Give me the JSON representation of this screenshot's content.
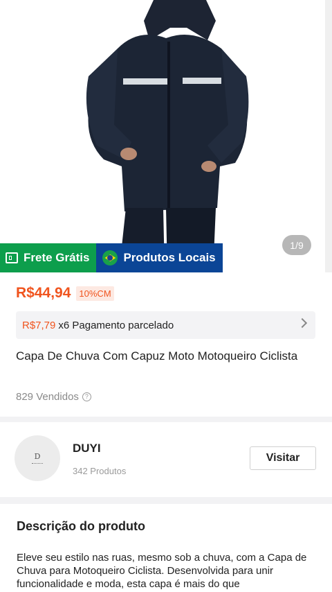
{
  "gallery": {
    "counter": "1/9"
  },
  "tags": {
    "free_shipping": "Frete Grátis",
    "local_products": "Produtos Locais"
  },
  "product": {
    "price": "R$44,94",
    "discount_badge": "10%CM",
    "installment_amount": "R$7,79",
    "installment_text": "x6 Pagamento parcelado",
    "title": "Capa De Chuva Com Capuz Moto Motoqueiro Ciclista",
    "sold": "829 Vendidos",
    "help_icon_glyph": "?"
  },
  "store": {
    "name": "DUYI",
    "products": "342 Produtos",
    "visit_label": "Visitar",
    "avatar_line": "D"
  },
  "description": {
    "heading": "Descrição do produto",
    "text": "Eleve seu estilo nas ruas, mesmo sob a chuva, com a Capa de Chuva para Motoqueiro Ciclista. Desenvolvida para unir funcionalidade e moda, esta capa é mais do que"
  },
  "colors": {
    "accent": "#f0541e",
    "free_green": "#0d9e4c",
    "local_blue": "#0b4596"
  }
}
